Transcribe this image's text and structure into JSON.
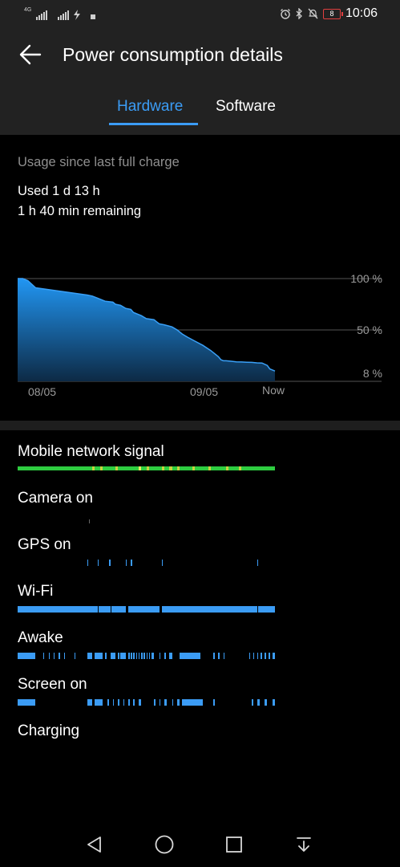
{
  "status_bar": {
    "network_type": "4G",
    "clock": "10:06",
    "battery_level": "8"
  },
  "header": {
    "title": "Power consumption details",
    "back_icon": "back-arrow-icon"
  },
  "tabs": [
    {
      "label": "Hardware",
      "active": true
    },
    {
      "label": "Software",
      "active": false
    }
  ],
  "summary": {
    "caption": "Usage since last full charge",
    "used": "Used 1 d 13 h",
    "remaining": "1 h 40 min remaining"
  },
  "chart_data": {
    "type": "area",
    "series": [
      {
        "x": [
          0.0,
          0.02,
          0.04,
          0.07,
          0.27,
          0.29,
          0.31,
          0.34,
          0.37,
          0.38,
          0.4,
          0.42,
          0.44,
          0.45,
          0.47,
          0.48,
          0.5,
          0.53,
          0.54,
          0.55,
          0.57,
          0.6,
          0.62,
          0.63,
          0.64,
          0.66,
          0.69,
          0.72,
          0.75,
          0.78,
          0.79,
          0.8,
          0.81,
          0.83,
          0.85,
          0.87,
          0.89,
          0.91,
          0.93,
          0.95,
          0.97,
          0.98,
          1.0
        ],
        "values": [
          100,
          100,
          98,
          91,
          84,
          83,
          81,
          78,
          77,
          75,
          74,
          71,
          70,
          67,
          65,
          64,
          61,
          60,
          58,
          56,
          55,
          53,
          50,
          48,
          46,
          43,
          39,
          35,
          30,
          24,
          21,
          20,
          20,
          19.5,
          19,
          18.8,
          18.6,
          18.4,
          18,
          17.8,
          15.5,
          12,
          10
        ]
      }
    ],
    "x_tick_labels": [
      "08/05",
      "09/05",
      "Now"
    ],
    "y_tick_labels": [
      "100 %",
      "50 %",
      "8 %"
    ],
    "ylim": [
      0,
      100
    ],
    "colors": {
      "fill_top": "#2196f3",
      "fill_bottom": "#0d2a45",
      "line": "#3aa0f7",
      "grid": "#555555"
    }
  },
  "usage_rows": [
    {
      "label": "Mobile network signal",
      "color": "#2ecc40",
      "segments": [
        [
          0,
          1,
          "#2ecc40"
        ],
        [
          0.29,
          0.3,
          "#c8d040"
        ],
        [
          0.32,
          0.33,
          "#c8d040"
        ],
        [
          0.38,
          0.39,
          "#c8d040"
        ],
        [
          0.47,
          0.48,
          "#e8e860"
        ],
        [
          0.5,
          0.51,
          "#c8d040"
        ],
        [
          0.56,
          0.57,
          "#c8d040"
        ],
        [
          0.59,
          0.6,
          "#c8d040"
        ],
        [
          0.62,
          0.63,
          "#c8d040"
        ],
        [
          0.68,
          0.69,
          "#c8d040"
        ],
        [
          0.74,
          0.75,
          "#c8d040"
        ],
        [
          0.81,
          0.82,
          "#c8d040"
        ],
        [
          0.86,
          0.87,
          "#c8d040"
        ]
      ]
    },
    {
      "label": "Camera on",
      "color": "#3b9cf5",
      "segments": [
        [
          0.277,
          0.281
        ]
      ]
    },
    {
      "label": "GPS on",
      "color": "#3b9cf5",
      "segments": [
        [
          0.27,
          0.275
        ],
        [
          0.31,
          0.316
        ],
        [
          0.355,
          0.36
        ],
        [
          0.42,
          0.425
        ],
        [
          0.44,
          0.445
        ],
        [
          0.56,
          0.565
        ],
        [
          0.93,
          0.935
        ]
      ]
    },
    {
      "label": "Wi-Fi",
      "color": "#3b9cf5",
      "segments": [
        [
          0,
          0.31
        ],
        [
          0.315,
          0.36
        ],
        [
          0.365,
          0.42
        ],
        [
          0.43,
          0.55
        ],
        [
          0.56,
          0.93
        ],
        [
          0.935,
          1
        ]
      ]
    },
    {
      "label": "Awake",
      "color": "#3b9cf5",
      "segments": [
        [
          0,
          0.07
        ],
        [
          0.1,
          0.104
        ],
        [
          0.12,
          0.124
        ],
        [
          0.14,
          0.144
        ],
        [
          0.16,
          0.164
        ],
        [
          0.18,
          0.184
        ],
        [
          0.22,
          0.225
        ],
        [
          0.27,
          0.29
        ],
        [
          0.3,
          0.33
        ],
        [
          0.34,
          0.345
        ],
        [
          0.36,
          0.38
        ],
        [
          0.39,
          0.395
        ],
        [
          0.4,
          0.42
        ],
        [
          0.43,
          0.435
        ],
        [
          0.44,
          0.445
        ],
        [
          0.45,
          0.455
        ],
        [
          0.46,
          0.465
        ],
        [
          0.47,
          0.475
        ],
        [
          0.48,
          0.485
        ],
        [
          0.49,
          0.495
        ],
        [
          0.5,
          0.505
        ],
        [
          0.51,
          0.515
        ],
        [
          0.52,
          0.53
        ],
        [
          0.55,
          0.555
        ],
        [
          0.57,
          0.575
        ],
        [
          0.59,
          0.6
        ],
        [
          0.63,
          0.71
        ],
        [
          0.76,
          0.765
        ],
        [
          0.78,
          0.785
        ],
        [
          0.8,
          0.805
        ],
        [
          0.9,
          0.905
        ],
        [
          0.915,
          0.92
        ],
        [
          0.93,
          0.935
        ],
        [
          0.945,
          0.95
        ],
        [
          0.96,
          0.965
        ],
        [
          0.975,
          0.98
        ],
        [
          0.99,
          1
        ]
      ]
    },
    {
      "label": "Screen on",
      "color": "#3b9cf5",
      "segments": [
        [
          0,
          0.07
        ],
        [
          0.27,
          0.29
        ],
        [
          0.3,
          0.33
        ],
        [
          0.35,
          0.355
        ],
        [
          0.37,
          0.375
        ],
        [
          0.39,
          0.395
        ],
        [
          0.41,
          0.415
        ],
        [
          0.43,
          0.435
        ],
        [
          0.45,
          0.455
        ],
        [
          0.47,
          0.48
        ],
        [
          0.53,
          0.535
        ],
        [
          0.55,
          0.555
        ],
        [
          0.57,
          0.58
        ],
        [
          0.6,
          0.605
        ],
        [
          0.62,
          0.63
        ],
        [
          0.64,
          0.72
        ],
        [
          0.76,
          0.765
        ],
        [
          0.91,
          0.915
        ],
        [
          0.93,
          0.94
        ],
        [
          0.96,
          0.97
        ],
        [
          0.99,
          1
        ]
      ]
    },
    {
      "label": "Charging",
      "color": "#3b9cf5",
      "segments": []
    }
  ],
  "nav_bar": {
    "icons": [
      "back-triangle-icon",
      "home-circle-icon",
      "recents-square-icon",
      "notification-pull-icon"
    ]
  }
}
